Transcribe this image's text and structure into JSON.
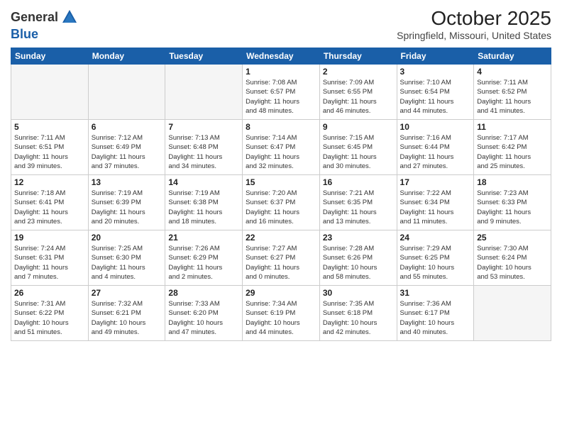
{
  "header": {
    "logo_general": "General",
    "logo_blue": "Blue",
    "month_year": "October 2025",
    "location": "Springfield, Missouri, United States"
  },
  "weekdays": [
    "Sunday",
    "Monday",
    "Tuesday",
    "Wednesday",
    "Thursday",
    "Friday",
    "Saturday"
  ],
  "weeks": [
    [
      {
        "day": "",
        "info": ""
      },
      {
        "day": "",
        "info": ""
      },
      {
        "day": "",
        "info": ""
      },
      {
        "day": "1",
        "info": "Sunrise: 7:08 AM\nSunset: 6:57 PM\nDaylight: 11 hours\nand 48 minutes."
      },
      {
        "day": "2",
        "info": "Sunrise: 7:09 AM\nSunset: 6:55 PM\nDaylight: 11 hours\nand 46 minutes."
      },
      {
        "day": "3",
        "info": "Sunrise: 7:10 AM\nSunset: 6:54 PM\nDaylight: 11 hours\nand 44 minutes."
      },
      {
        "day": "4",
        "info": "Sunrise: 7:11 AM\nSunset: 6:52 PM\nDaylight: 11 hours\nand 41 minutes."
      }
    ],
    [
      {
        "day": "5",
        "info": "Sunrise: 7:11 AM\nSunset: 6:51 PM\nDaylight: 11 hours\nand 39 minutes."
      },
      {
        "day": "6",
        "info": "Sunrise: 7:12 AM\nSunset: 6:49 PM\nDaylight: 11 hours\nand 37 minutes."
      },
      {
        "day": "7",
        "info": "Sunrise: 7:13 AM\nSunset: 6:48 PM\nDaylight: 11 hours\nand 34 minutes."
      },
      {
        "day": "8",
        "info": "Sunrise: 7:14 AM\nSunset: 6:47 PM\nDaylight: 11 hours\nand 32 minutes."
      },
      {
        "day": "9",
        "info": "Sunrise: 7:15 AM\nSunset: 6:45 PM\nDaylight: 11 hours\nand 30 minutes."
      },
      {
        "day": "10",
        "info": "Sunrise: 7:16 AM\nSunset: 6:44 PM\nDaylight: 11 hours\nand 27 minutes."
      },
      {
        "day": "11",
        "info": "Sunrise: 7:17 AM\nSunset: 6:42 PM\nDaylight: 11 hours\nand 25 minutes."
      }
    ],
    [
      {
        "day": "12",
        "info": "Sunrise: 7:18 AM\nSunset: 6:41 PM\nDaylight: 11 hours\nand 23 minutes."
      },
      {
        "day": "13",
        "info": "Sunrise: 7:19 AM\nSunset: 6:39 PM\nDaylight: 11 hours\nand 20 minutes."
      },
      {
        "day": "14",
        "info": "Sunrise: 7:19 AM\nSunset: 6:38 PM\nDaylight: 11 hours\nand 18 minutes."
      },
      {
        "day": "15",
        "info": "Sunrise: 7:20 AM\nSunset: 6:37 PM\nDaylight: 11 hours\nand 16 minutes."
      },
      {
        "day": "16",
        "info": "Sunrise: 7:21 AM\nSunset: 6:35 PM\nDaylight: 11 hours\nand 13 minutes."
      },
      {
        "day": "17",
        "info": "Sunrise: 7:22 AM\nSunset: 6:34 PM\nDaylight: 11 hours\nand 11 minutes."
      },
      {
        "day": "18",
        "info": "Sunrise: 7:23 AM\nSunset: 6:33 PM\nDaylight: 11 hours\nand 9 minutes."
      }
    ],
    [
      {
        "day": "19",
        "info": "Sunrise: 7:24 AM\nSunset: 6:31 PM\nDaylight: 11 hours\nand 7 minutes."
      },
      {
        "day": "20",
        "info": "Sunrise: 7:25 AM\nSunset: 6:30 PM\nDaylight: 11 hours\nand 4 minutes."
      },
      {
        "day": "21",
        "info": "Sunrise: 7:26 AM\nSunset: 6:29 PM\nDaylight: 11 hours\nand 2 minutes."
      },
      {
        "day": "22",
        "info": "Sunrise: 7:27 AM\nSunset: 6:27 PM\nDaylight: 11 hours\nand 0 minutes."
      },
      {
        "day": "23",
        "info": "Sunrise: 7:28 AM\nSunset: 6:26 PM\nDaylight: 10 hours\nand 58 minutes."
      },
      {
        "day": "24",
        "info": "Sunrise: 7:29 AM\nSunset: 6:25 PM\nDaylight: 10 hours\nand 55 minutes."
      },
      {
        "day": "25",
        "info": "Sunrise: 7:30 AM\nSunset: 6:24 PM\nDaylight: 10 hours\nand 53 minutes."
      }
    ],
    [
      {
        "day": "26",
        "info": "Sunrise: 7:31 AM\nSunset: 6:22 PM\nDaylight: 10 hours\nand 51 minutes."
      },
      {
        "day": "27",
        "info": "Sunrise: 7:32 AM\nSunset: 6:21 PM\nDaylight: 10 hours\nand 49 minutes."
      },
      {
        "day": "28",
        "info": "Sunrise: 7:33 AM\nSunset: 6:20 PM\nDaylight: 10 hours\nand 47 minutes."
      },
      {
        "day": "29",
        "info": "Sunrise: 7:34 AM\nSunset: 6:19 PM\nDaylight: 10 hours\nand 44 minutes."
      },
      {
        "day": "30",
        "info": "Sunrise: 7:35 AM\nSunset: 6:18 PM\nDaylight: 10 hours\nand 42 minutes."
      },
      {
        "day": "31",
        "info": "Sunrise: 7:36 AM\nSunset: 6:17 PM\nDaylight: 10 hours\nand 40 minutes."
      },
      {
        "day": "",
        "info": ""
      }
    ]
  ]
}
